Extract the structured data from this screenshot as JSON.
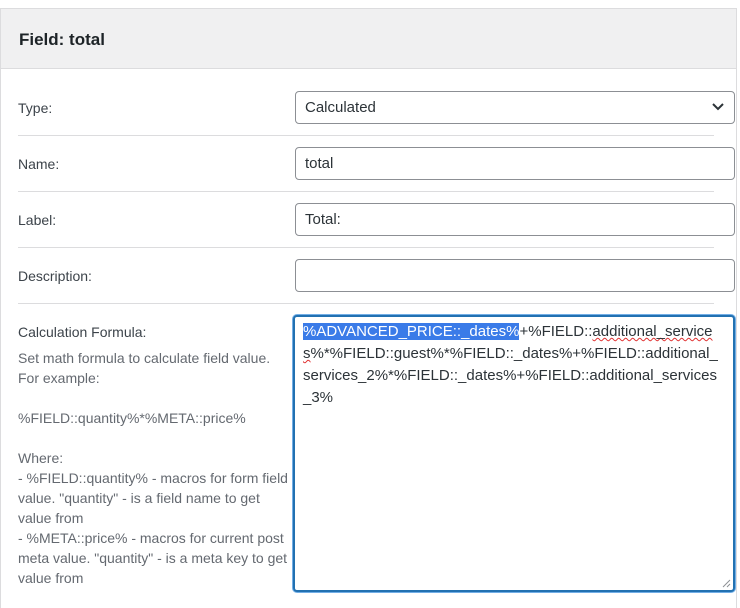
{
  "panel": {
    "title": "Field: total"
  },
  "fields": {
    "type": {
      "label": "Type:",
      "value": "Calculated"
    },
    "name": {
      "label": "Name:",
      "value": "total"
    },
    "label": {
      "label": "Label:",
      "value": "Total:"
    },
    "description": {
      "label": "Description:",
      "value": ""
    },
    "formula": {
      "label": "Calculation Formula:",
      "selected_text": "%ADVANCED_PRICE::_dates%",
      "plus": "+%FIELD::",
      "spell_word": "additional_services",
      "rest": "%*%FIELD::guest%*%FIELD::_dates%+%FIELD::additional_services_2%*%FIELD::_dates%+%FIELD::additional_services_3%"
    }
  },
  "help": {
    "line1": "Set math formula to calculate field value.",
    "line2": "For example:",
    "example": "%FIELD::quantity%*%META::price%",
    "where": "Where:",
    "item1": "- %FIELD::quantity% - macros for form field value. \"quantity\" - is a field name to get value from",
    "item2": "- %META::price% - macros for current post meta value. \"quantity\" - is a meta key to get value from"
  },
  "icons": {
    "select_arrow": "chevron-down-icon",
    "resize": "resize-handle-icon"
  }
}
